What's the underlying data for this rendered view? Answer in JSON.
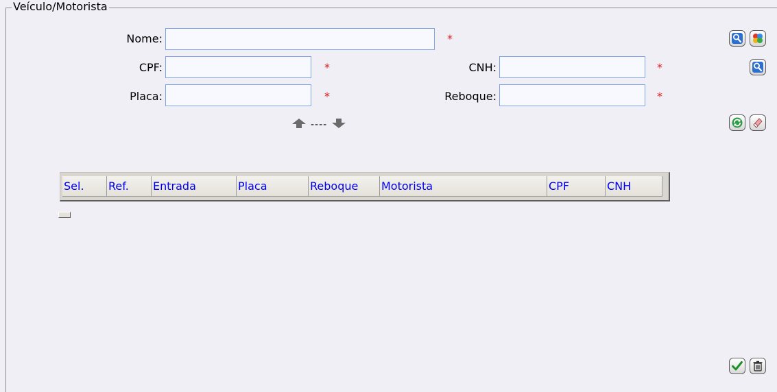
{
  "fieldset": {
    "legend": "Veículo/Motorista"
  },
  "form": {
    "nome": {
      "label": "Nome:",
      "value": "",
      "placeholder": "",
      "required": "*"
    },
    "cpf": {
      "label": "CPF:",
      "value": "",
      "placeholder": "",
      "required": "*"
    },
    "cnh": {
      "label": "CNH:",
      "value": "",
      "placeholder": "",
      "required": "*"
    },
    "placa": {
      "label": "Placa:",
      "value": "",
      "placeholder": "",
      "required": "*"
    },
    "reboque": {
      "label": "Reboque:",
      "value": "",
      "placeholder": "",
      "required": "*"
    }
  },
  "navigation": {
    "separator": "----"
  },
  "grid": {
    "columns": [
      "Sel.",
      "Ref.",
      "Entrada",
      "Placa",
      "Reboque",
      "Motorista",
      "CPF",
      "CNH"
    ],
    "rows": []
  },
  "icons": {
    "search_driver": "search-icon",
    "color_options": "colors-icon",
    "search_cnh": "search-icon",
    "refresh": "refresh-icon",
    "clear": "eraser-icon",
    "confirm": "checkmark-icon",
    "delete": "trash-icon"
  },
  "colors": {
    "background": "#f0eff5",
    "required_asterisk": "#e01c1c",
    "grid_header_text": "#0000f0",
    "input_border": "#7fa4e6"
  }
}
